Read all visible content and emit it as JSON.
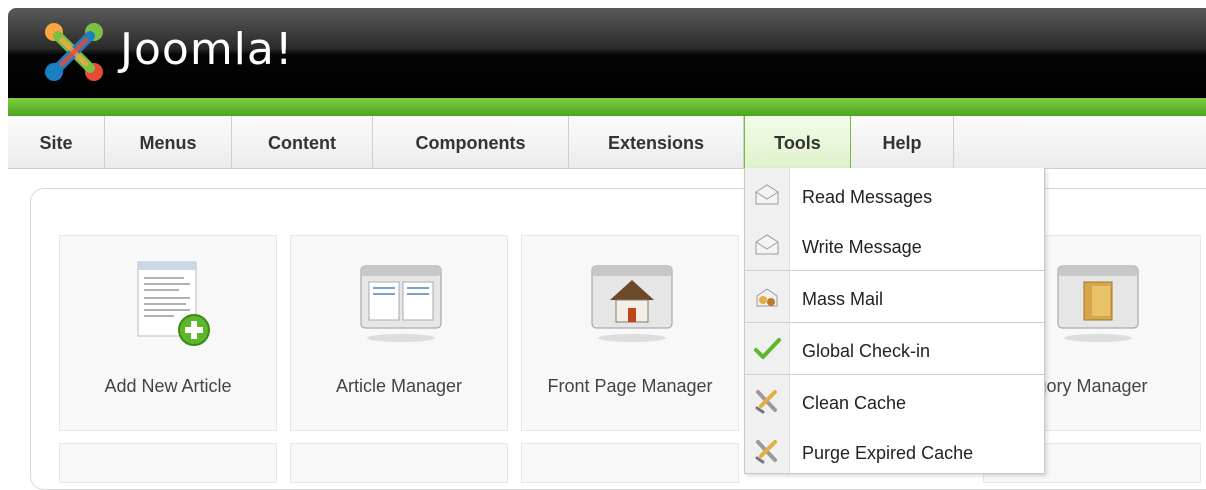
{
  "brand": {
    "name": "Joomla!"
  },
  "menu": [
    {
      "label": "Site"
    },
    {
      "label": "Menus"
    },
    {
      "label": "Content"
    },
    {
      "label": "Components"
    },
    {
      "label": "Extensions"
    },
    {
      "label": "Tools",
      "active": true
    },
    {
      "label": "Help"
    }
  ],
  "tiles": [
    {
      "label": "Add New Article",
      "icon": "add-article-icon"
    },
    {
      "label": "Article Manager",
      "icon": "article-manager-icon"
    },
    {
      "label": "Front Page Manager",
      "icon": "home-icon"
    },
    {
      "label": "gory Manager",
      "icon": "folder-icon"
    }
  ],
  "tools_menu": [
    {
      "label": "Read Messages",
      "icon": "message-read-icon"
    },
    {
      "label": "Write Message",
      "icon": "message-write-icon"
    },
    {
      "label": "Mass Mail",
      "icon": "mass-mail-icon"
    },
    {
      "label": "Global Check-in",
      "icon": "checkmark-icon"
    },
    {
      "label": "Clean Cache",
      "icon": "clean-cache-icon"
    },
    {
      "label": "Purge Expired Cache",
      "icon": "purge-cache-icon"
    }
  ],
  "colors": {
    "accent_green": "#5cb82a",
    "header_black": "#000000"
  }
}
